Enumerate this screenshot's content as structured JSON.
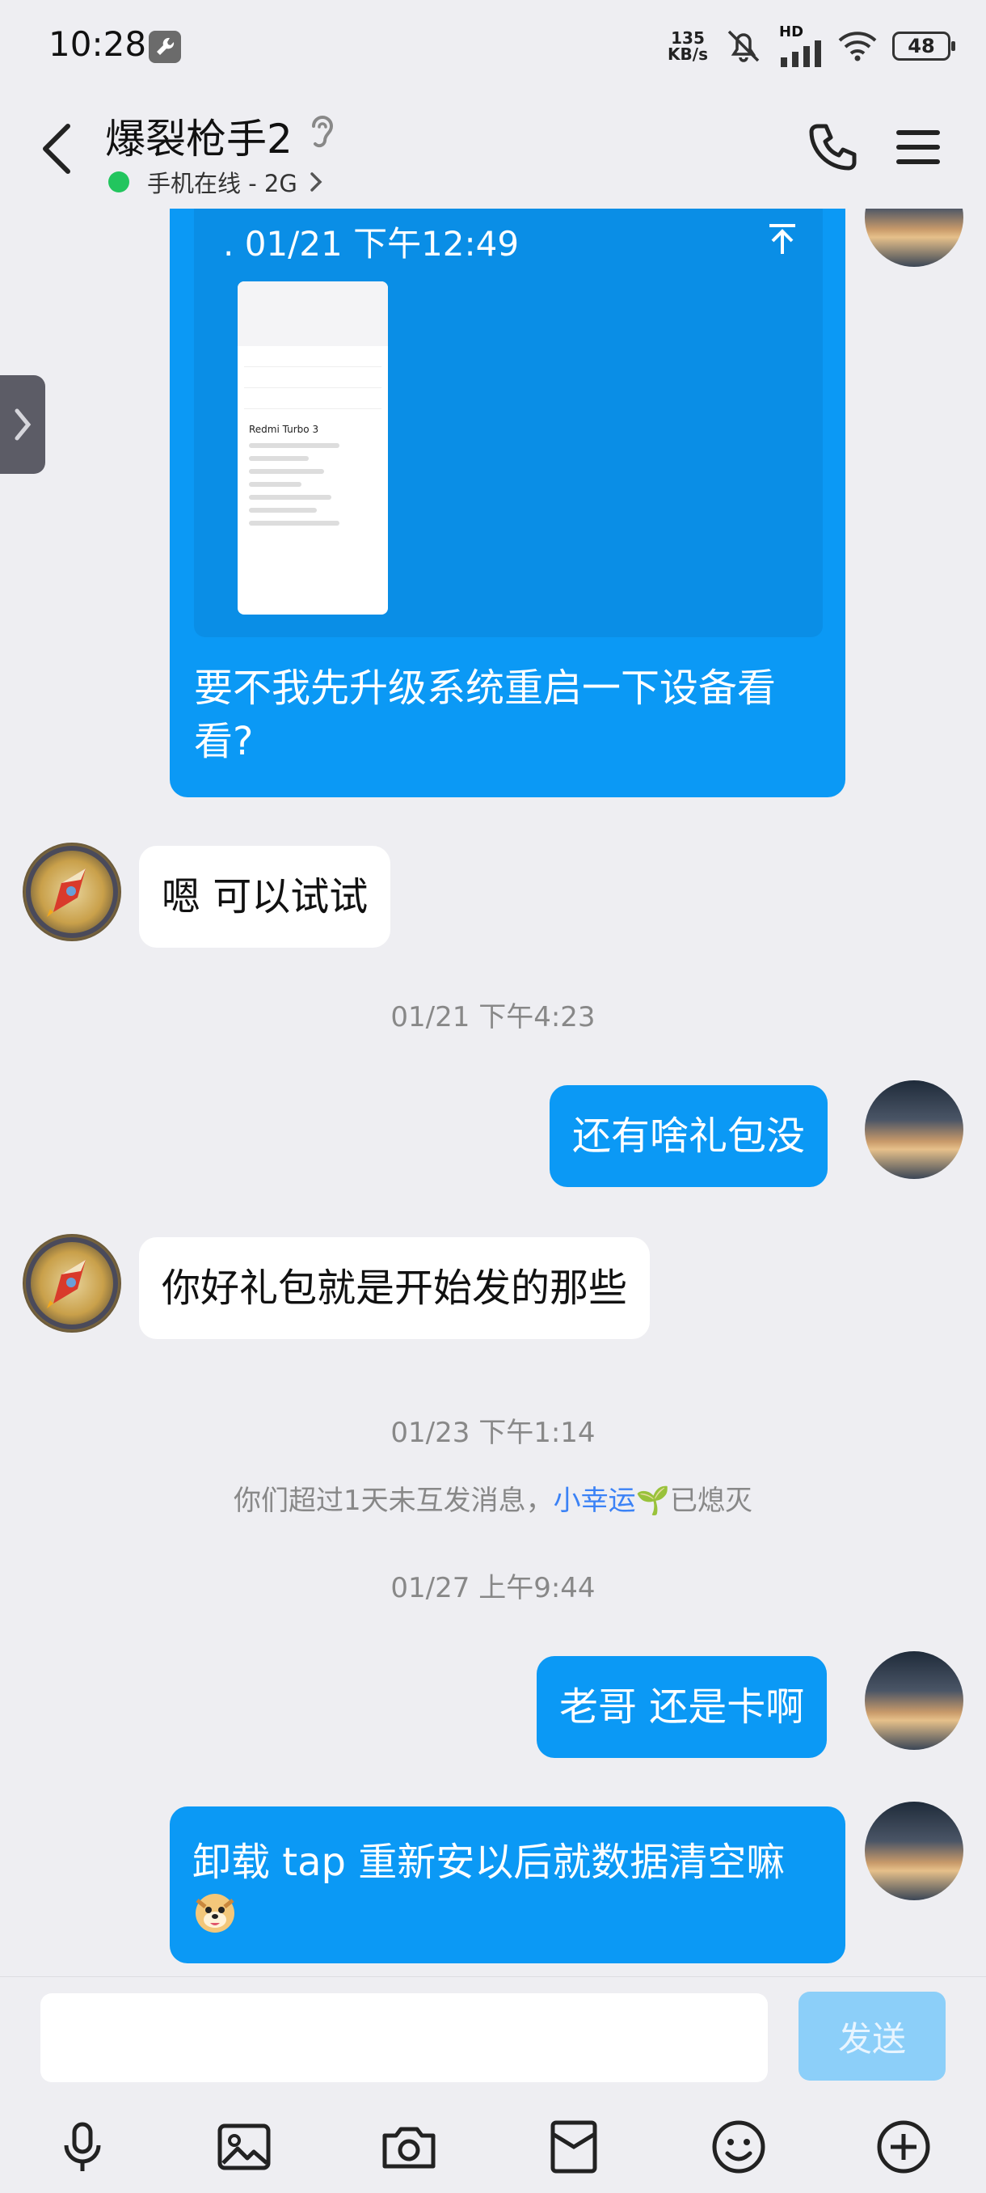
{
  "status_bar": {
    "time": "10:28",
    "net_speed_value": "135",
    "net_speed_unit": "KB/s",
    "hd_label": "HD",
    "battery": "48"
  },
  "header": {
    "title": "爆裂枪手2",
    "presence": "手机在线 - 2G"
  },
  "messages": {
    "quoted": {
      "time": ". 01/21 下午12:49",
      "screenshot_model": "Redmi Turbo 3",
      "text": "要不我先升级系统重启一下设备看看?"
    },
    "m1": "嗯 可以试试",
    "ts1": "01/21 下午4:23",
    "m2": "还有啥礼包没",
    "m3": "你好礼包就是开始发的那些",
    "ts2": "01/23 下午1:14",
    "system_prefix": "你们超过1天未互发消息，",
    "system_highlight": "小幸运",
    "system_suffix": "已熄灭",
    "ts3": "01/27 上午9:44",
    "m4": "老哥 还是卡啊",
    "m5": "卸载 tap 重新安以后就数据清空嘛"
  },
  "composer": {
    "input_value": "",
    "send_label": "发送"
  },
  "colors": {
    "accent": "#0b99f5",
    "online": "#22c55e",
    "highlight": "#3b82f6"
  }
}
